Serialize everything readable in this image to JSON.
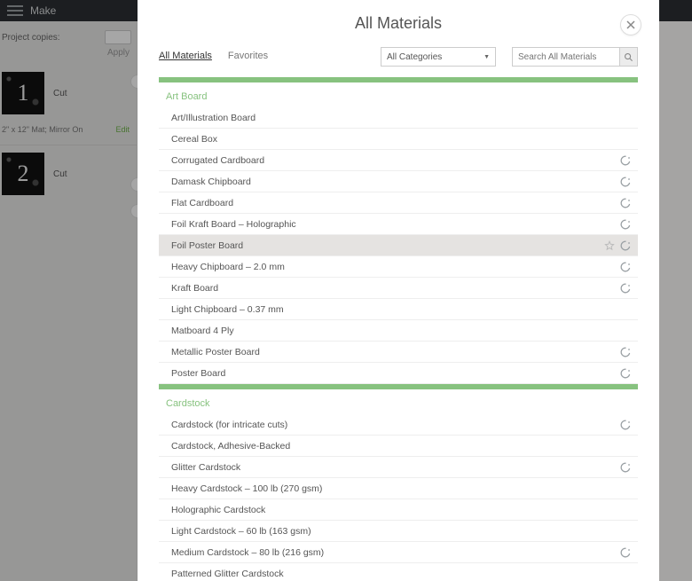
{
  "app": {
    "title": "Make"
  },
  "sidebar": {
    "copies_label": "Project copies:",
    "apply_label": "Apply",
    "mats": [
      {
        "num": "1",
        "action": "Cut",
        "meta": "2\" x 12\" Mat; Mirror On",
        "edit": "Edit"
      },
      {
        "num": "2",
        "action": "Cut"
      }
    ]
  },
  "modal": {
    "title": "All Materials",
    "tabs": {
      "all": "All Materials",
      "fav": "Favorites"
    },
    "category_selected": "All Categories",
    "search_placeholder": "Search All Materials",
    "groups": [
      {
        "name": "Art Board",
        "items": [
          {
            "name": "Art/Illustration Board"
          },
          {
            "name": "Cereal Box"
          },
          {
            "name": "Corrugated Cardboard",
            "brand": true
          },
          {
            "name": "Damask Chipboard",
            "brand": true
          },
          {
            "name": "Flat Cardboard",
            "brand": true
          },
          {
            "name": "Foil Kraft Board  – Holographic",
            "brand": true
          },
          {
            "name": "Foil Poster Board",
            "brand": true,
            "star": true,
            "highlight": true
          },
          {
            "name": "Heavy Chipboard – 2.0 mm",
            "brand": true
          },
          {
            "name": "Kraft Board",
            "brand": true
          },
          {
            "name": "Light Chipboard – 0.37 mm"
          },
          {
            "name": "Matboard 4 Ply"
          },
          {
            "name": "Metallic Poster Board",
            "brand": true
          },
          {
            "name": "Poster Board",
            "brand": true
          }
        ]
      },
      {
        "name": "Cardstock",
        "items": [
          {
            "name": "Cardstock (for intricate cuts)",
            "brand": true
          },
          {
            "name": "Cardstock, Adhesive-Backed"
          },
          {
            "name": "Glitter Cardstock",
            "brand": true
          },
          {
            "name": "Heavy Cardstock – 100 lb (270 gsm)"
          },
          {
            "name": "Holographic Cardstock"
          },
          {
            "name": "Light Cardstock – 60 lb (163 gsm)"
          },
          {
            "name": "Medium Cardstock – 80 lb (216 gsm)",
            "brand": true
          },
          {
            "name": "Patterned Glitter Cardstock"
          }
        ]
      }
    ]
  }
}
